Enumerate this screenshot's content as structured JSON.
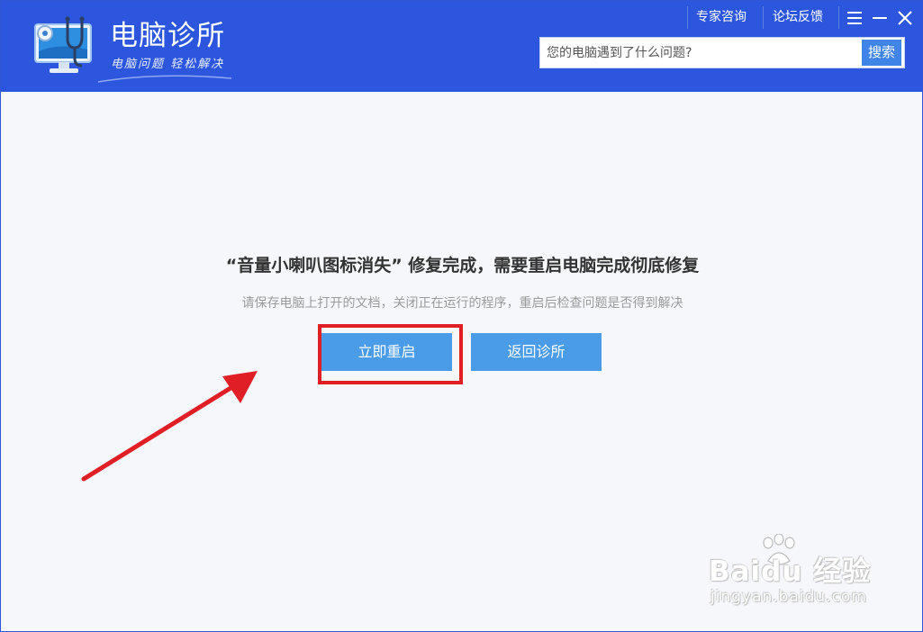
{
  "app": {
    "title": "电脑诊所",
    "slogan": "电脑问题 轻松解决"
  },
  "top_links": {
    "expert": "专家咨询",
    "forum": "论坛反馈"
  },
  "window_controls": [
    "menu-icon",
    "minimize-icon",
    "close-icon"
  ],
  "search": {
    "placeholder": "您的电脑遇到了什么问题?",
    "button_label": "搜索"
  },
  "main": {
    "headline": "“音量小喇叭图标消失” 修复完成，需要重启电脑完成彻底修复",
    "subline": "请保存电脑上打开的文档，关闭正在运行的程序，重启后检查问题是否得到解决",
    "restart_button": "立即重启",
    "back_button": "返回诊所"
  },
  "annotation": {
    "highlight_color": "#e01e26",
    "arrow_color": "#e01e26"
  },
  "watermark": {
    "main": "Baidu 经验",
    "sub": "jingyan.baidu.com"
  },
  "colors": {
    "header": "#2d56de",
    "button": "#4a9be8",
    "search_button": "#3f84e6"
  }
}
